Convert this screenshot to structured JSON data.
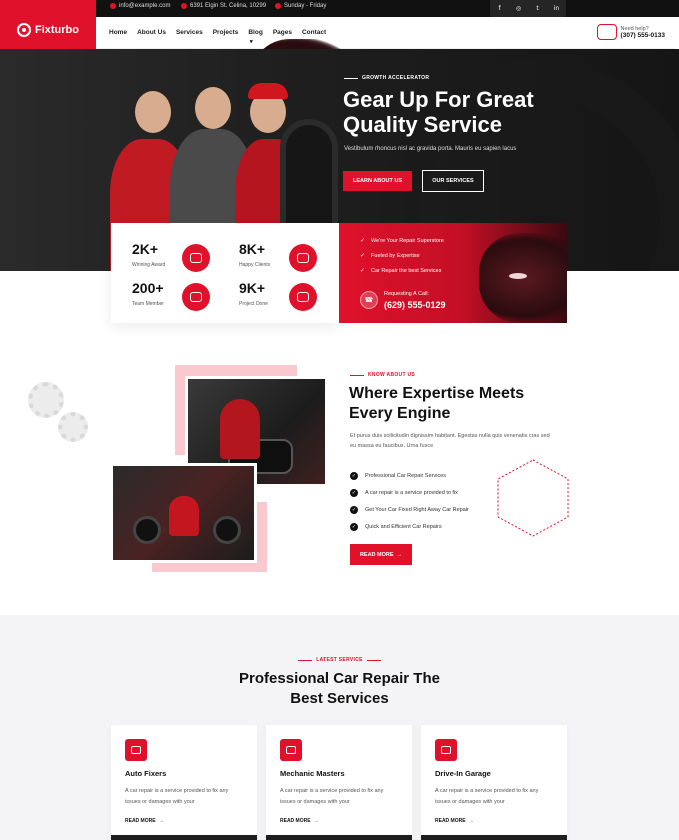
{
  "topbar": {
    "email": "info@example.com",
    "address": "6391 Elgin St. Celina, 10299",
    "hours": "Sunday - Friday",
    "socials": [
      "f",
      "◎",
      "t",
      "in"
    ]
  },
  "brand": {
    "name": "Fixturbo"
  },
  "nav": {
    "items": [
      {
        "label": "Home",
        "caret": "▾"
      },
      {
        "label": "About Us",
        "caret": ""
      },
      {
        "label": "Services",
        "caret": "▾"
      },
      {
        "label": "Projects",
        "caret": "▾"
      },
      {
        "label": "Blog",
        "caret": "▾"
      },
      {
        "label": "Pages",
        "caret": "▾"
      },
      {
        "label": "Contact",
        "caret": ""
      }
    ],
    "help_label": "Need help?",
    "help_phone": "(307) 555-0133"
  },
  "hero": {
    "eyebrow": "GROWTH ACCELERATOR",
    "title": "Gear Up For Great Quality Service",
    "subtitle": "Vestibulum rhoncus nisl ac gravida porta. Mauris eu sapien lacus",
    "primary_button": "LEARN ABOUT US",
    "secondary_button": "OUR SERVICES"
  },
  "stats": [
    {
      "value": "2K+",
      "label": "Winning Award"
    },
    {
      "value": "8K+",
      "label": "Happy Clients"
    },
    {
      "value": "200+",
      "label": "Team Member"
    },
    {
      "value": "9K+",
      "label": "Project Done"
    }
  ],
  "promo": {
    "features": [
      "We're Your Repair Superstore",
      "Fueled by Expertise",
      "Car Repair the best Services"
    ],
    "call_label": "Requesting A Call:",
    "call_number": "(629) 555-0129"
  },
  "about": {
    "eyebrow": "KNOW ABOUT US",
    "title": "Where Expertise Meets Every Engine",
    "text": "Et purus duis sollicitudin dignissim habitant. Egestas nulla quis venenatis cras sed eu massa eu faucibus. Urna fusce",
    "list": [
      "Professional Car Repair Services",
      "A car repair is a service provided to fix",
      "Get Your Car Fixed Right Away Car Repair",
      "Quick and Efficient Car Repairs"
    ],
    "button": "READ MORE",
    "arrow": "→"
  },
  "services": {
    "eyebrow": "LATEST SERVICE",
    "title": "Professional Car Repair The Best Services",
    "cards": [
      {
        "title": "Auto Fixers",
        "desc": "A car repair is a service provided to fix any issues or damages with your",
        "link": "READ MORE"
      },
      {
        "title": "Mechanic Masters",
        "desc": "A car repair is a service provided to fix any issues or damages with your",
        "link": "READ MORE"
      },
      {
        "title": "Drive-In Garage",
        "desc": "A car repair is a service provided to fix any issues or damages with your",
        "link": "READ MORE"
      }
    ]
  },
  "colors": {
    "accent": "#e0112b",
    "dark": "#111111"
  }
}
